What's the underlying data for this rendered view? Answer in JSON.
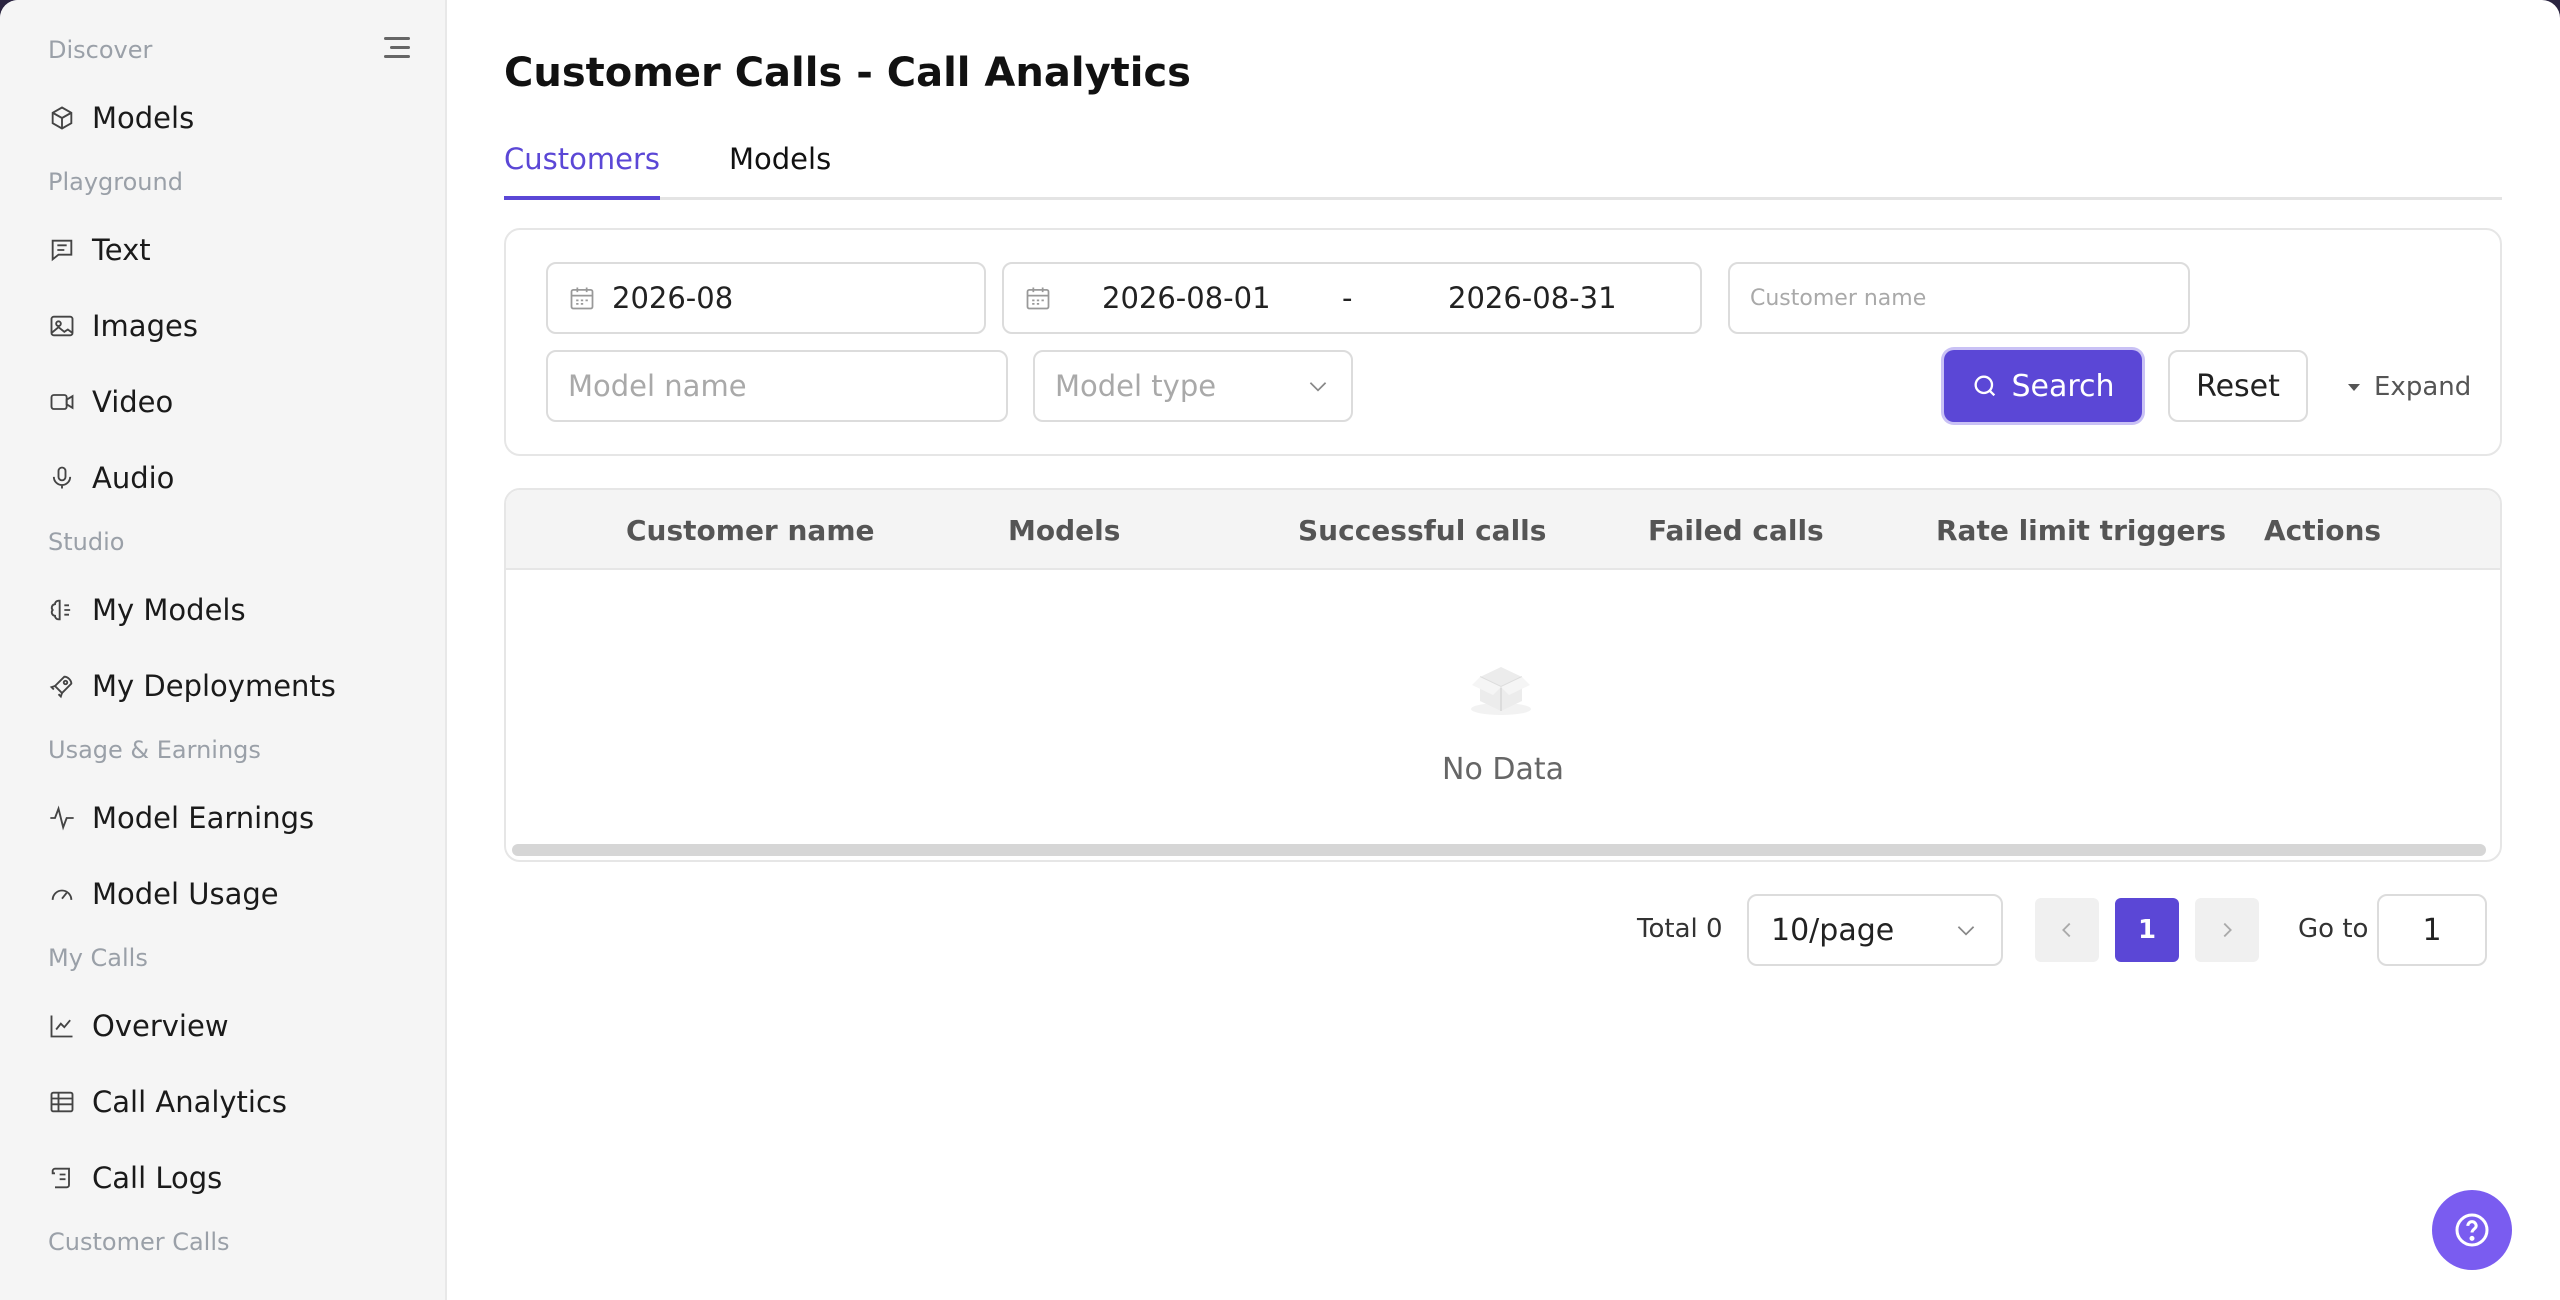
{
  "sidebar": {
    "sections": [
      {
        "label": "Discover"
      },
      {
        "label": "Playground"
      },
      {
        "label": "Studio"
      },
      {
        "label": "Usage & Earnings"
      },
      {
        "label": "My Calls"
      },
      {
        "label": "Customer Calls"
      }
    ],
    "items": [
      {
        "label": "Models",
        "icon": "cube-icon"
      },
      {
        "label": "Text",
        "icon": "message-icon"
      },
      {
        "label": "Images",
        "icon": "image-icon"
      },
      {
        "label": "Video",
        "icon": "video-icon"
      },
      {
        "label": "Audio",
        "icon": "microphone-icon"
      },
      {
        "label": "My Models",
        "icon": "brain-icon"
      },
      {
        "label": "My Deployments",
        "icon": "rocket-icon"
      },
      {
        "label": "Model Earnings",
        "icon": "pulse-icon"
      },
      {
        "label": "Model Usage",
        "icon": "gauge-icon"
      },
      {
        "label": "Overview",
        "icon": "line-chart-icon"
      },
      {
        "label": "Call Analytics",
        "icon": "table-icon"
      },
      {
        "label": "Call Logs",
        "icon": "scroll-icon"
      }
    ]
  },
  "page": {
    "title": "Customer Calls - Call Analytics"
  },
  "tabs": [
    {
      "label": "Customers",
      "active": true
    },
    {
      "label": "Models",
      "active": false
    }
  ],
  "filters": {
    "month": "2026-08",
    "range_start": "2026-08-01",
    "range_separator": "-",
    "range_end": "2026-08-31",
    "customer_placeholder": "Customer name",
    "model_name_placeholder": "Model name",
    "model_type_placeholder": "Model type",
    "search_label": "Search",
    "reset_label": "Reset",
    "expand_label": "Expand"
  },
  "table": {
    "columns": [
      "Customer name",
      "Models",
      "Successful calls",
      "Failed calls",
      "Rate limit triggers",
      "Actions"
    ],
    "rows": [],
    "empty_text": "No Data"
  },
  "pagination": {
    "total": "Total 0",
    "page_size": "10/page",
    "current_page": "1",
    "goto_label": "Go to",
    "goto_value": "1"
  },
  "colors": {
    "accent": "#5b47d6",
    "help_button": "#7a5cf0"
  }
}
